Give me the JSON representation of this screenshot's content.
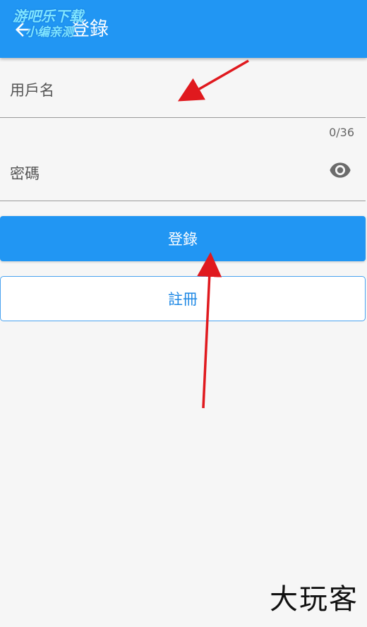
{
  "appbar": {
    "title": "登錄",
    "back_icon": "arrow-left-icon",
    "watermark_line1": "游吧乐下载",
    "watermark_line2": "小编亲测"
  },
  "form": {
    "username_label": "用戶名",
    "counter": "0/36",
    "password_label": "密碼",
    "visibility_icon": "eye-icon"
  },
  "buttons": {
    "login": "登錄",
    "register": "註冊"
  },
  "brand_watermark": "大玩客",
  "colors": {
    "primary": "#2196f3",
    "annotation_arrow": "#e0191e"
  }
}
